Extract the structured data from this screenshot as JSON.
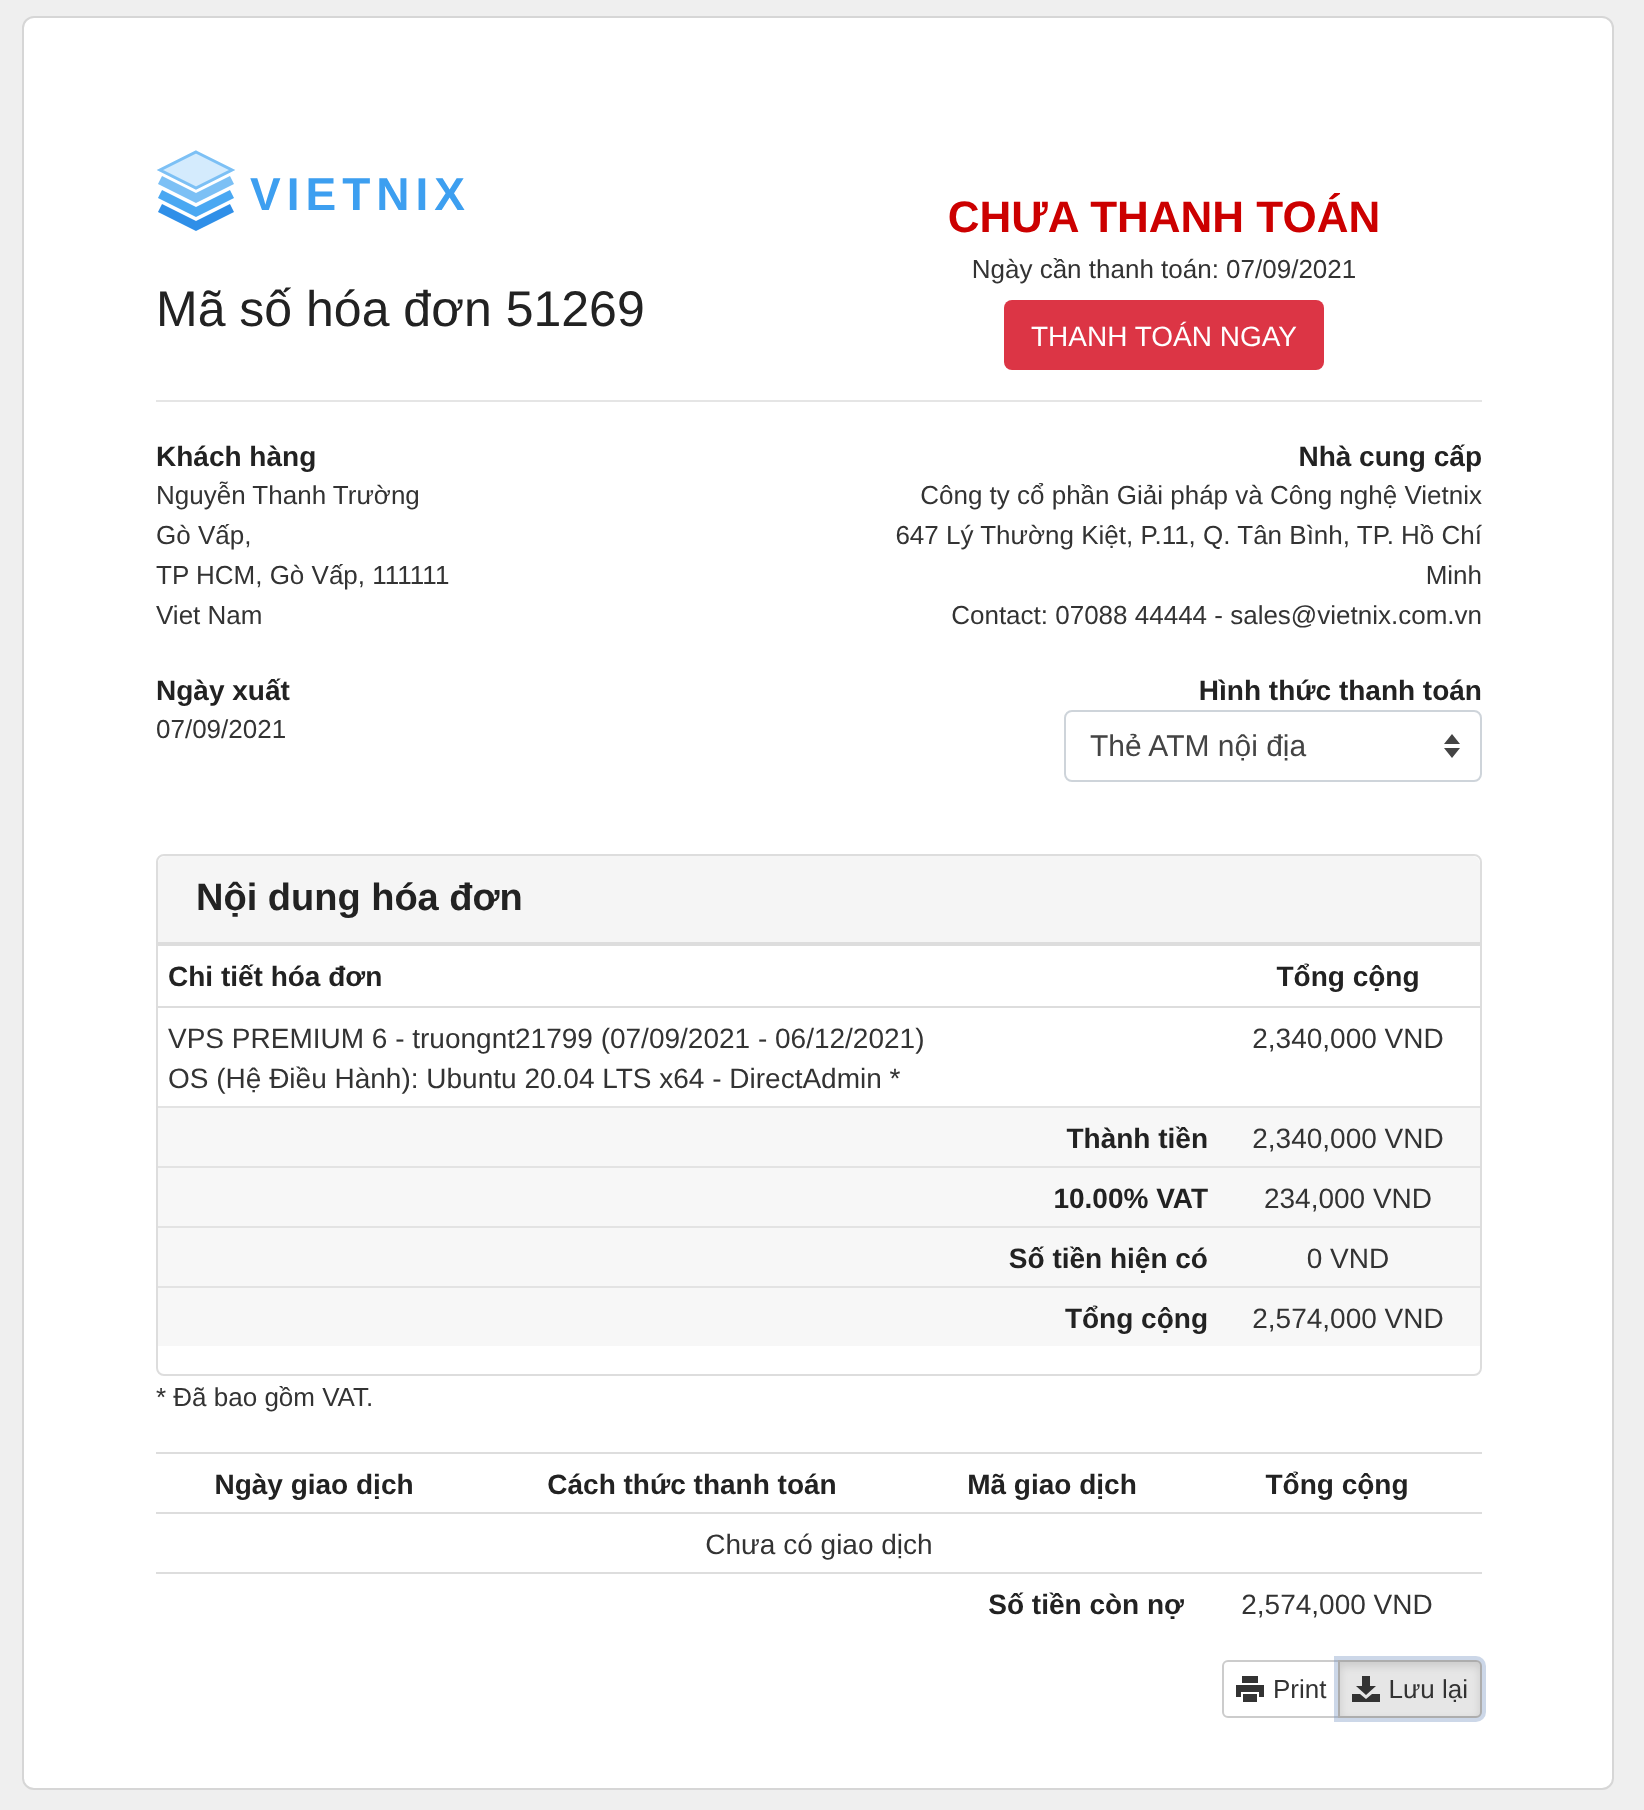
{
  "header": {
    "logo_text": "VIETNIX",
    "invoice_title": "Mã số hóa đơn 51269",
    "status": "CHƯA THANH TOÁN",
    "due_date": "Ngày cần thanh toán: 07/09/2021",
    "pay_button": "THANH TOÁN NGAY"
  },
  "parties": {
    "customer": {
      "heading": "Khách hàng",
      "lines": [
        "Nguyễn Thanh Trường",
        "Gò Vấp,",
        "TP HCM, Gò Vấp, 111111",
        "Viet Nam"
      ]
    },
    "supplier": {
      "heading": "Nhà cung cấp",
      "lines": [
        "Công ty cổ phần Giải pháp và Công nghệ Vietnix",
        "647 Lý Thường Kiệt, P.11, Q. Tân Bình, TP. Hồ Chí Minh",
        "Contact: 07088 44444 - sales@vietnix.com.vn"
      ]
    }
  },
  "issue_date": {
    "heading": "Ngày xuất",
    "value": "07/09/2021"
  },
  "payment_method": {
    "heading": "Hình thức thanh toán",
    "value": "Thẻ ATM nội địa"
  },
  "invoice_items": {
    "title": "Nội dung hóa đơn",
    "columns": [
      "Chi tiết hóa đơn",
      "Tổng cộng"
    ],
    "rows": [
      {
        "lines": [
          "VPS PREMIUM 6 - truongnt21799 (07/09/2021 - 06/12/2021)",
          "OS (Hệ Điều Hành): Ubuntu 20.04 LTS x64 - DirectAdmin *"
        ],
        "amount": "2,340,000 VND"
      }
    ],
    "totals": [
      {
        "label": "Thành tiền",
        "amount": "2,340,000 VND"
      },
      {
        "label": "10.00% VAT",
        "amount": "234,000 VND"
      },
      {
        "label": "Số tiền hiện có",
        "amount": "0 VND"
      },
      {
        "label": "Tổng cộng",
        "amount": "2,574,000 VND"
      }
    ]
  },
  "note": "* Đã bao gồm VAT.",
  "transactions": {
    "columns": [
      "Ngày giao dịch",
      "Cách thức thanh toán",
      "Mã giao dịch",
      "Tổng cộng"
    ],
    "empty_message": "Chưa có giao dịch",
    "balance": {
      "label": "Số tiền còn nợ",
      "amount": "2,574,000 VND"
    }
  },
  "actions": [
    {
      "kind": "print",
      "label": "Print",
      "active": false
    },
    {
      "kind": "save",
      "label": "Lưu lại",
      "active": true
    }
  ]
}
